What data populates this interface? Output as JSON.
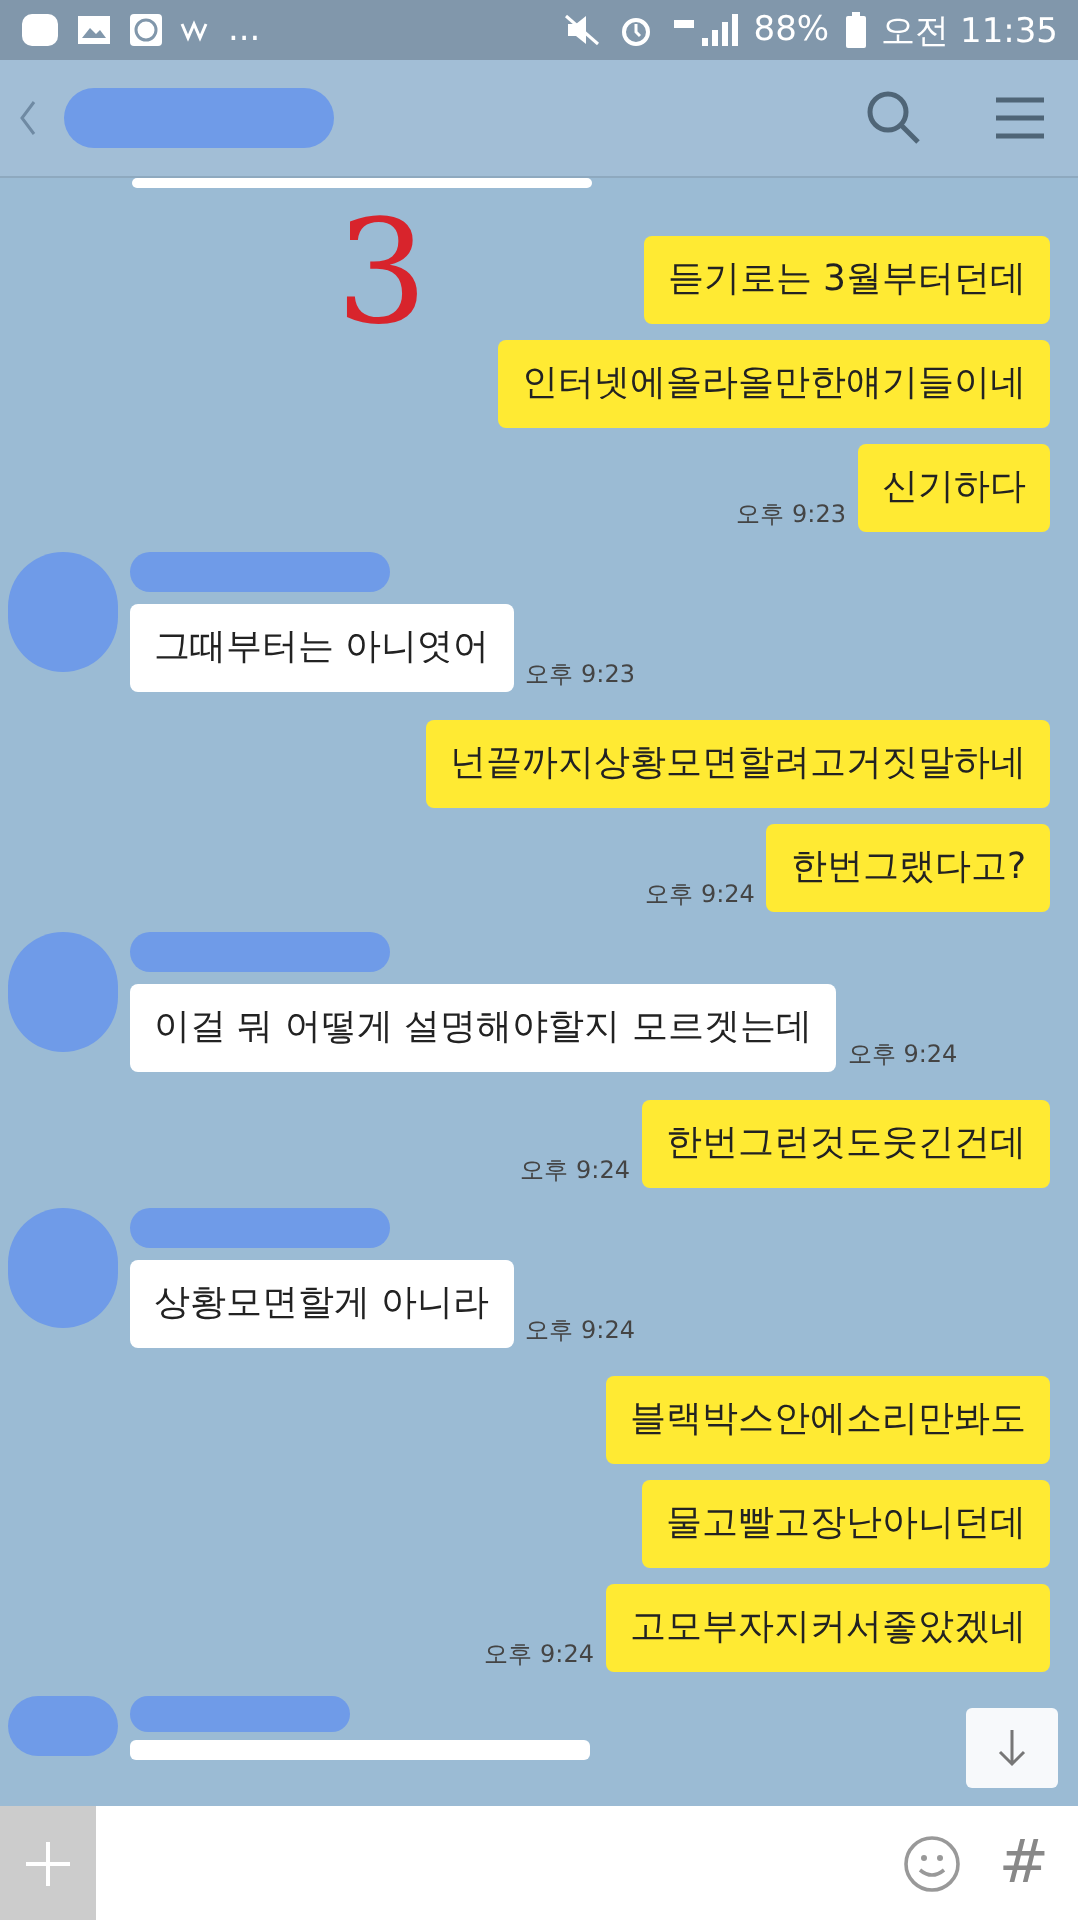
{
  "status_bar": {
    "more": "...",
    "battery": "88%",
    "time": "오전 11:35"
  },
  "overlay_mark": "3",
  "messages": [
    {
      "kind": "received_partial"
    },
    {
      "kind": "sent",
      "text": "듣기로는 3월부터던데"
    },
    {
      "kind": "sent",
      "text": "인터넷에올라올만한얘기들이네"
    },
    {
      "kind": "sent",
      "text": "신기하다",
      "time": "오후 9:23"
    },
    {
      "kind": "received",
      "text": "그때부터는 아니엿어",
      "time": "오후 9:23"
    },
    {
      "kind": "sent",
      "text": "넌끝까지상황모면할려고거짓말하네"
    },
    {
      "kind": "sent",
      "text": "한번그랬다고?",
      "time": "오후 9:24"
    },
    {
      "kind": "received",
      "text": "이걸 뭐 어떻게 설명해야할지 모르겟는데",
      "time": "오후 9:24"
    },
    {
      "kind": "sent",
      "text": "한번그런것도웃긴건데",
      "time": "오후 9:24"
    },
    {
      "kind": "received",
      "text": "상황모면할게 아니라",
      "time": "오후 9:24"
    },
    {
      "kind": "sent",
      "text": "블랙박스안에소리만봐도"
    },
    {
      "kind": "sent",
      "text": "물고빨고장난아니던데"
    },
    {
      "kind": "sent",
      "text": "고모부자지커서좋았겠네",
      "time": "오후 9:24"
    },
    {
      "kind": "received_partial"
    }
  ],
  "composer": {
    "hash": "#"
  }
}
